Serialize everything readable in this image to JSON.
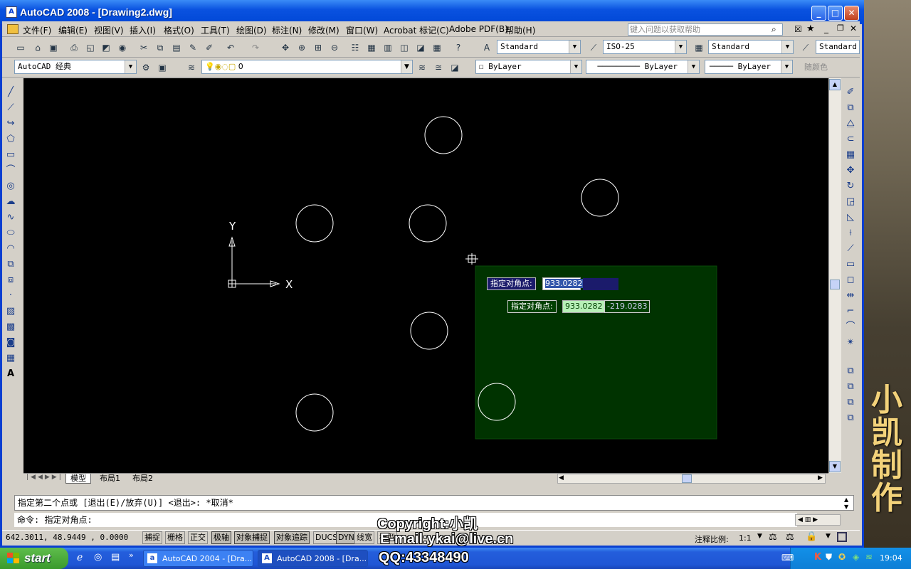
{
  "window": {
    "title": "AutoCAD 2008 - [Drawing2.dwg]",
    "buttons": [
      "_",
      "□",
      "✕"
    ]
  },
  "menu": {
    "items": [
      "文件(F)",
      "编辑(E)",
      "视图(V)",
      "插入(I)",
      "格式(O)",
      "工具(T)",
      "绘图(D)",
      "标注(N)",
      "修改(M)",
      "窗口(W)",
      "Acrobat 标记(C)",
      "Adobe PDF(B)",
      "帮助(H)"
    ],
    "help_placeholder": "键入问题以获取帮助"
  },
  "styles_toolbar": {
    "text_style": "Standard",
    "dim_style": "ISO-25",
    "table_style": "Standard",
    "multileader_style": "Standard"
  },
  "workspace_toolbar": {
    "workspace": "AutoCAD 经典",
    "layer": "0",
    "color": "ByLayer",
    "linetype": "ByLayer",
    "lineweight": "ByLayer",
    "plotstyle": "随颜色"
  },
  "canvas": {
    "background": "#000000",
    "ucs_x": "X",
    "ucs_y": "Y",
    "selection_fill": "#003300",
    "dynamic_input": {
      "prompt1": "指定对角点:",
      "value1": "933.0282",
      "prompt2": "指定对角点:",
      "value2a": "933.0282",
      "value2b": "-219.0283"
    }
  },
  "layout_tabs": [
    "模型",
    "布局1",
    "布局2"
  ],
  "command": {
    "history": "指定第二个点或 [退出(E)/放弃(U)] <退出>:  *取消*",
    "input": "命令: 指定对角点:"
  },
  "status": {
    "coords": "642.3011,  48.9449 , 0.0000",
    "toggles": [
      "捕捉",
      "栅格",
      "正交",
      "极轴",
      "对象捕捉",
      "对象追踪",
      "DUCS",
      "DYN",
      "线宽",
      "模型"
    ],
    "annotation_scale_label": "注释比例:",
    "annotation_scale": "1:1"
  },
  "watermark": {
    "copyright": "Copyright:小凯",
    "email": "E-mail:ykai@live.cn",
    "qq": "QQ:43348490",
    "vertical": "小凯制作"
  },
  "taskbar": {
    "start": "start",
    "tasks": [
      "AutoCAD 2004 - [Dra...",
      "AutoCAD 2008 - [Dra..."
    ],
    "clock": "19:04"
  }
}
